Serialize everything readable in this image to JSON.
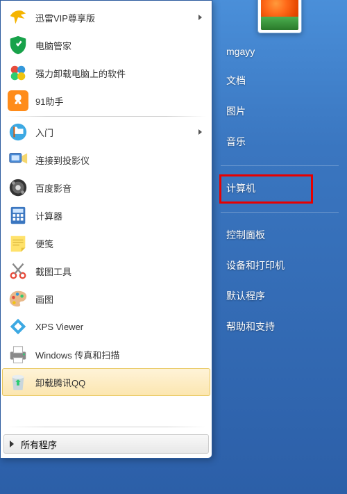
{
  "user": {
    "name": "mgayy"
  },
  "left": {
    "pinned": [
      {
        "icon": "thunder-bird-icon",
        "label": "迅雷VIP尊享版",
        "submenu": true
      },
      {
        "icon": "pc-manager-icon",
        "label": "电脑管家"
      },
      {
        "icon": "uninstall-tool-icon",
        "label": "强力卸载电脑上的软件"
      },
      {
        "icon": "91-assistant-icon",
        "label": "91助手"
      }
    ],
    "recent": [
      {
        "icon": "getting-started-icon",
        "label": "入门",
        "submenu": true
      },
      {
        "icon": "projector-icon",
        "label": "连接到投影仪"
      },
      {
        "icon": "baidu-player-icon",
        "label": "百度影音"
      },
      {
        "icon": "calculator-icon",
        "label": "计算器"
      },
      {
        "icon": "sticky-notes-icon",
        "label": "便笺"
      },
      {
        "icon": "snipping-tool-icon",
        "label": "截图工具"
      },
      {
        "icon": "paint-icon",
        "label": "画图"
      },
      {
        "icon": "xps-viewer-icon",
        "label": "XPS Viewer"
      },
      {
        "icon": "fax-scan-icon",
        "label": "Windows 传真和扫描"
      },
      {
        "icon": "recycle-bin-icon",
        "label": "卸载腾讯QQ",
        "highlighted": true
      }
    ],
    "all_programs": "所有程序"
  },
  "right": {
    "personal": [
      {
        "label_ref": "user.name"
      },
      {
        "label": "文档"
      },
      {
        "label": "图片"
      },
      {
        "label": "音乐"
      }
    ],
    "system": [
      {
        "label": "计算机"
      }
    ],
    "settings": [
      {
        "label": "控制面板",
        "highlighted": true
      },
      {
        "label": "设备和打印机"
      },
      {
        "label": "默认程序"
      },
      {
        "label": "帮助和支持"
      }
    ]
  },
  "icons": {
    "thunder-bird-icon": "bird",
    "pc-manager-icon": "shield",
    "uninstall-tool-icon": "clover",
    "91-assistant-icon": "butterfly",
    "getting-started-icon": "flag",
    "projector-icon": "projector",
    "baidu-player-icon": "film",
    "calculator-icon": "calc",
    "sticky-notes-icon": "note",
    "snipping-tool-icon": "scissors",
    "paint-icon": "palette",
    "xps-viewer-icon": "xps",
    "fax-scan-icon": "fax",
    "recycle-bin-icon": "bin"
  }
}
